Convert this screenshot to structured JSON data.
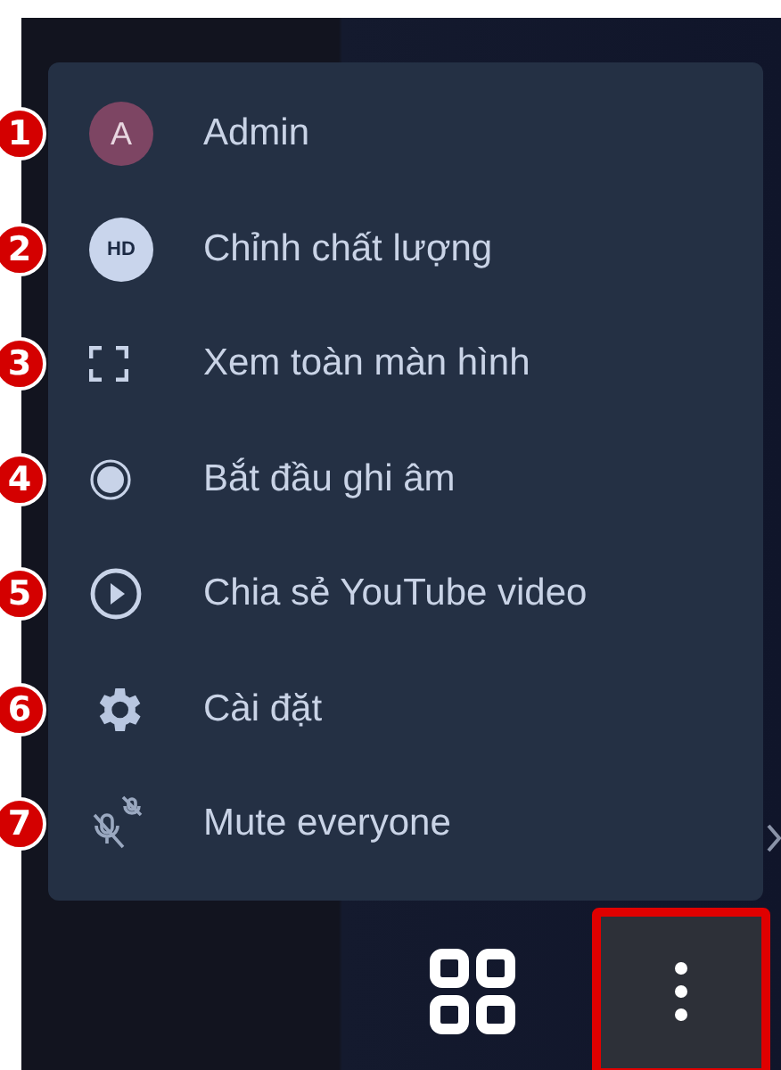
{
  "menu": {
    "items": [
      {
        "badge": "1",
        "kind": "avatar",
        "icon_text": "A",
        "label": "Admin"
      },
      {
        "badge": "2",
        "kind": "hd",
        "icon_text": "HD",
        "label": "Chỉnh chất lượng"
      },
      {
        "badge": "3",
        "kind": "fullscreen",
        "label": "Xem toàn màn hình"
      },
      {
        "badge": "4",
        "kind": "record",
        "label": "Bắt đầu ghi âm"
      },
      {
        "badge": "5",
        "kind": "play",
        "label": "Chia sẻ YouTube video"
      },
      {
        "badge": "6",
        "kind": "gear",
        "label": "Cài đặt"
      },
      {
        "badge": "7",
        "kind": "mute",
        "label": "Mute everyone"
      }
    ]
  },
  "toolbar": {
    "more_button": {
      "highlighted": true
    }
  }
}
